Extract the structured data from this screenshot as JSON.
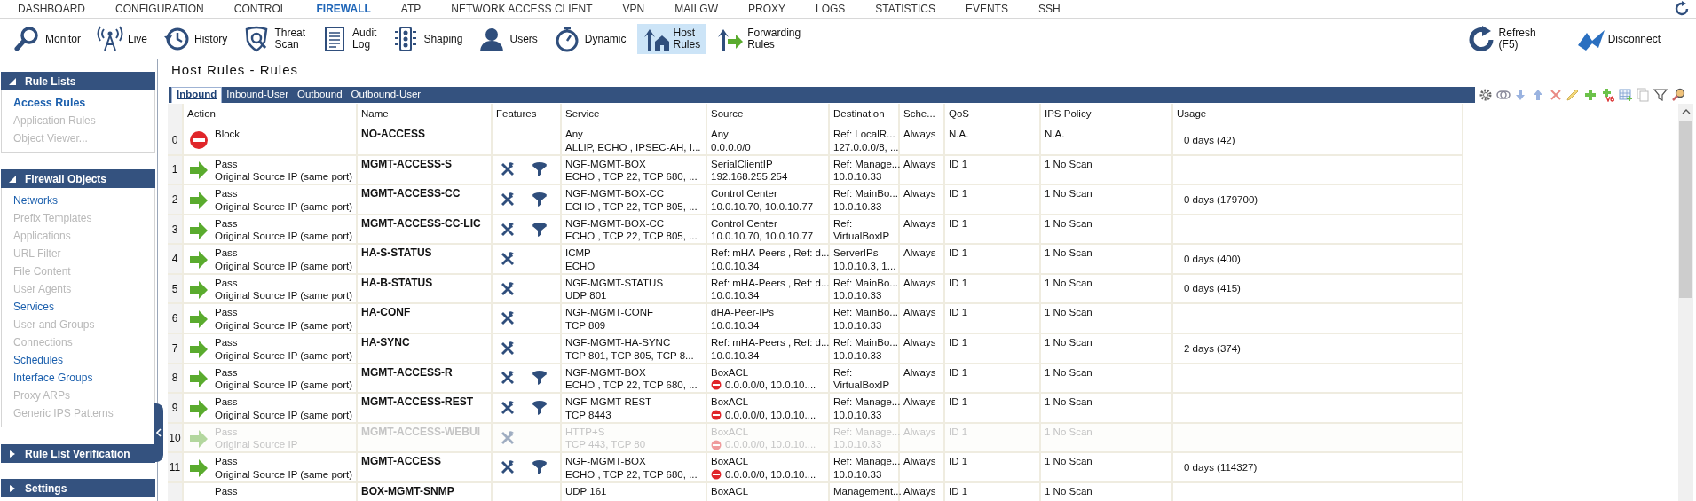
{
  "top_nav": [
    {
      "label": "DASHBOARD",
      "selected": false
    },
    {
      "label": "CONFIGURATION",
      "selected": false
    },
    {
      "label": "CONTROL",
      "selected": false
    },
    {
      "label": "FIREWALL",
      "selected": true
    },
    {
      "label": "ATP",
      "selected": false
    },
    {
      "label": "NETWORK ACCESS CLIENT",
      "selected": false
    },
    {
      "label": "VPN",
      "selected": false
    },
    {
      "label": "MAILGW",
      "selected": false
    },
    {
      "label": "PROXY",
      "selected": false
    },
    {
      "label": "LOGS",
      "selected": false
    },
    {
      "label": "STATISTICS",
      "selected": false
    },
    {
      "label": "EVENTS",
      "selected": false
    },
    {
      "label": "SSH",
      "selected": false
    }
  ],
  "toolbar": [
    {
      "kind": "monitor",
      "label": "Monitor",
      "selected": false
    },
    {
      "kind": "live",
      "label": "Live",
      "selected": false
    },
    {
      "kind": "history",
      "label": "History",
      "selected": false
    },
    {
      "kind": "threat",
      "label": "Threat Scan",
      "selected": false
    },
    {
      "kind": "audit",
      "label": "Audit Log",
      "selected": false
    },
    {
      "kind": "shaping",
      "label": "Shaping",
      "selected": false
    },
    {
      "kind": "users",
      "label": "Users",
      "selected": false
    },
    {
      "kind": "dynamic",
      "label": "Dynamic",
      "selected": false
    },
    {
      "kind": "host",
      "label": "Host Rules",
      "selected": true
    },
    {
      "kind": "forwarding",
      "label": "Forwarding Rules",
      "selected": false
    }
  ],
  "toolbar_right": [
    {
      "kind": "refresh",
      "label": "Refresh (F5)"
    },
    {
      "kind": "disconnect",
      "label": "Disconnect"
    }
  ],
  "sidebar": [
    {
      "title": "Rule Lists",
      "expanded": true,
      "items": [
        {
          "label": "Access Rules",
          "enabled": true,
          "selected": true
        },
        {
          "label": "Application Rules",
          "enabled": false,
          "selected": false
        },
        {
          "label": "Object Viewer...",
          "enabled": false,
          "selected": false
        }
      ]
    },
    {
      "title": "Firewall Objects",
      "expanded": true,
      "items": [
        {
          "label": "Networks",
          "enabled": true,
          "selected": false
        },
        {
          "label": "Prefix Templates",
          "enabled": false,
          "selected": false
        },
        {
          "label": "Applications",
          "enabled": false,
          "selected": false
        },
        {
          "label": "URL Filter",
          "enabled": false,
          "selected": false
        },
        {
          "label": "File Content",
          "enabled": false,
          "selected": false
        },
        {
          "label": "User Agents",
          "enabled": false,
          "selected": false
        },
        {
          "label": "Services",
          "enabled": true,
          "selected": false
        },
        {
          "label": "User and Groups",
          "enabled": false,
          "selected": false
        },
        {
          "label": "Connections",
          "enabled": false,
          "selected": false
        },
        {
          "label": "Schedules",
          "enabled": true,
          "selected": false
        },
        {
          "label": "Interface Groups",
          "enabled": true,
          "selected": false
        },
        {
          "label": "Proxy ARPs",
          "enabled": false,
          "selected": false
        },
        {
          "label": "Generic IPS Patterns",
          "enabled": false,
          "selected": false
        }
      ]
    },
    {
      "title": "Rule List Verification",
      "expanded": false
    },
    {
      "title": "Settings",
      "expanded": false
    }
  ],
  "page_title": "Host Rules - Rules",
  "tabs": [
    {
      "label": "Inbound",
      "selected": true
    },
    {
      "label": "Inbound-User",
      "selected": false
    },
    {
      "label": "Outbound",
      "selected": false
    },
    {
      "label": "Outbound-User",
      "selected": false
    }
  ],
  "table": {
    "columns": [
      "Action",
      "Name",
      "Features",
      "Service",
      "Source",
      "Destination",
      "Sche...",
      "QoS",
      "IPS Policy",
      "Usage"
    ],
    "rows": [
      {
        "number": "0",
        "kind": "block",
        "action_label": "Block",
        "name": "NO-ACCESS",
        "tools": false,
        "filter": false,
        "service": [
          "Any",
          "ALLIP, ECHO , IPSEC-AH, I..."
        ],
        "source": [
          "Any",
          "0.0.0.0/0"
        ],
        "source_negated": false,
        "destination": [
          "Ref: LocalR...",
          "127.0.0.0/8, ..."
        ],
        "schedule": "Always",
        "qos": "N.A.",
        "ips": "N.A.",
        "usage": "0 days (42)",
        "disabled": false
      },
      {
        "number": "1",
        "kind": "pass",
        "action_label": "Pass",
        "nat": "Original Source IP (same port)",
        "name": "MGMT-ACCESS-S",
        "tools": true,
        "filter": true,
        "service": [
          "NGF-MGMT-BOX",
          "ECHO , TCP 22, TCP 680, ..."
        ],
        "source": [
          "SerialClientIP",
          "192.168.255.254"
        ],
        "source_negated": false,
        "destination": [
          "Ref: Manage...",
          "10.0.10.33"
        ],
        "schedule": "Always",
        "qos": "ID 1",
        "ips": "1 No Scan",
        "disabled": false
      },
      {
        "number": "2",
        "kind": "pass",
        "action_label": "Pass",
        "nat": "Original Source IP (same port)",
        "name": "MGMT-ACCESS-CC",
        "tools": true,
        "filter": true,
        "service": [
          "NGF-MGMT-BOX-CC",
          "ECHO , TCP 22, TCP 805, ..."
        ],
        "source": [
          "Control Center",
          "10.0.10.70, 10.0.10.77"
        ],
        "source_negated": false,
        "destination": [
          "Ref: MainBo...",
          "10.0.10.33"
        ],
        "schedule": "Always",
        "qos": "ID 1",
        "ips": "1 No Scan",
        "usage": "0 days (179700)",
        "disabled": false
      },
      {
        "number": "3",
        "kind": "pass",
        "action_label": "Pass",
        "nat": "Original Source IP (same port)",
        "name": "MGMT-ACCESS-CC-LIC",
        "tools": true,
        "filter": true,
        "service": [
          "NGF-MGMT-BOX-CC",
          "ECHO , TCP 22, TCP 805, ..."
        ],
        "source": [
          "Control Center",
          "10.0.10.70, 10.0.10.77"
        ],
        "source_negated": false,
        "destination": [
          "Ref:",
          "VirtualBoxIP"
        ],
        "schedule": "Always",
        "qos": "ID 1",
        "ips": "1 No Scan",
        "disabled": false
      },
      {
        "number": "4",
        "kind": "pass",
        "action_label": "Pass",
        "nat": "Original Source IP (same port)",
        "name": "HA-S-STATUS",
        "tools": true,
        "filter": false,
        "service": [
          "ICMP",
          "ECHO"
        ],
        "source": [
          "Ref: mHA-Peers , Ref: d...",
          "10.0.10.34"
        ],
        "source_negated": false,
        "destination": [
          "ServerIPs",
          "10.0.10.3, 1..."
        ],
        "schedule": "Always",
        "qos": "ID 1",
        "ips": "1 No Scan",
        "usage": "0 days (400)",
        "disabled": false
      },
      {
        "number": "5",
        "kind": "pass",
        "action_label": "Pass",
        "nat": "Original Source IP (same port)",
        "name": "HA-B-STATUS",
        "tools": true,
        "filter": false,
        "service": [
          "NGF-MGMT-STATUS",
          "UDP 801"
        ],
        "source": [
          "Ref: mHA-Peers , Ref: d...",
          "10.0.10.34"
        ],
        "source_negated": false,
        "destination": [
          "Ref: MainBo...",
          "10.0.10.33"
        ],
        "schedule": "Always",
        "qos": "ID 1",
        "ips": "1 No Scan",
        "usage": "0 days (415)",
        "disabled": false
      },
      {
        "number": "6",
        "kind": "pass",
        "action_label": "Pass",
        "nat": "Original Source IP (same port)",
        "name": "HA-CONF",
        "tools": true,
        "filter": false,
        "service": [
          "NGF-MGMT-CONF",
          "TCP 809"
        ],
        "source": [
          "dHA-Peer-IPs",
          "10.0.10.34"
        ],
        "source_negated": false,
        "destination": [
          "Ref: MainBo...",
          "10.0.10.33"
        ],
        "schedule": "Always",
        "qos": "ID 1",
        "ips": "1 No Scan",
        "disabled": false
      },
      {
        "number": "7",
        "kind": "pass",
        "action_label": "Pass",
        "nat": "Original Source IP (same port)",
        "name": "HA-SYNC",
        "tools": true,
        "filter": false,
        "service": [
          "NGF-MGMT-HA-SYNC",
          "TCP 801, TCP 805, TCP 8..."
        ],
        "source": [
          "Ref: mHA-Peers , Ref: d...",
          "10.0.10.34"
        ],
        "source_negated": false,
        "destination": [
          "Ref: MainBo...",
          "10.0.10.33"
        ],
        "schedule": "Always",
        "qos": "ID 1",
        "ips": "1 No Scan",
        "usage": "2 days (374)",
        "disabled": false
      },
      {
        "number": "8",
        "kind": "pass",
        "action_label": "Pass",
        "nat": "Original Source IP (same port)",
        "name": "MGMT-ACCESS-R",
        "tools": true,
        "filter": true,
        "service": [
          "NGF-MGMT-BOX",
          "ECHO , TCP 22, TCP 680, ..."
        ],
        "source": [
          "BoxACL",
          "0.0.0.0/0, 10.0.10...."
        ],
        "source_negated": true,
        "destination": [
          "Ref:",
          "VirtualBoxIP"
        ],
        "schedule": "Always",
        "qos": "ID 1",
        "ips": "1 No Scan",
        "disabled": false
      },
      {
        "number": "9",
        "kind": "pass",
        "action_label": "Pass",
        "nat": "Original Source IP (same port)",
        "name": "MGMT-ACCESS-REST",
        "tools": true,
        "filter": true,
        "service": [
          "NGF-MGMT-REST",
          "TCP 8443"
        ],
        "source": [
          "BoxACL",
          "0.0.0.0/0, 10.0.10...."
        ],
        "source_negated": true,
        "destination": [
          "Ref: Manage...",
          "10.0.10.33"
        ],
        "schedule": "Always",
        "qos": "ID 1",
        "ips": "1 No Scan",
        "disabled": false
      },
      {
        "number": "10",
        "kind": "pass",
        "action_label": "Pass",
        "nat": "Original Source IP",
        "name": "MGMT-ACCESS-WEBUI",
        "tools": true,
        "filter": false,
        "service": [
          "HTTP+S",
          "TCP 443, TCP 80"
        ],
        "source": [
          "BoxACL",
          "0.0.0.0/0, 10.0.10...."
        ],
        "source_negated": true,
        "destination": [
          "Ref: Manage...",
          "10.0.10.33"
        ],
        "schedule": "Always",
        "qos": "ID 1",
        "ips": "1 No Scan",
        "disabled": true
      },
      {
        "number": "11",
        "kind": "pass",
        "action_label": "Pass",
        "nat": "Original Source IP (same port)",
        "name": "MGMT-ACCESS",
        "tools": true,
        "filter": true,
        "service": [
          "NGF-MGMT-BOX",
          "ECHO , TCP 22, TCP 680, ..."
        ],
        "source": [
          "BoxACL",
          "0.0.0.0/0, 10.0.10...."
        ],
        "source_negated": true,
        "destination": [
          "Ref: Manage...",
          "10.0.10.33"
        ],
        "schedule": "Always",
        "qos": "ID 1",
        "ips": "1 No Scan",
        "usage": "0 days (114327)",
        "disabled": false
      },
      {
        "action_label": "Pass",
        "name": "BOX-MGMT-SNMP",
        "tools": false,
        "filter": false,
        "service": [
          "UDP 161"
        ],
        "source": [
          "BoxACL"
        ],
        "source_negated": false,
        "destination": [
          "Management..."
        ],
        "schedule": "Always",
        "qos": "ID 1",
        "ips": "1 No Scan",
        "disabled": false
      }
    ]
  }
}
